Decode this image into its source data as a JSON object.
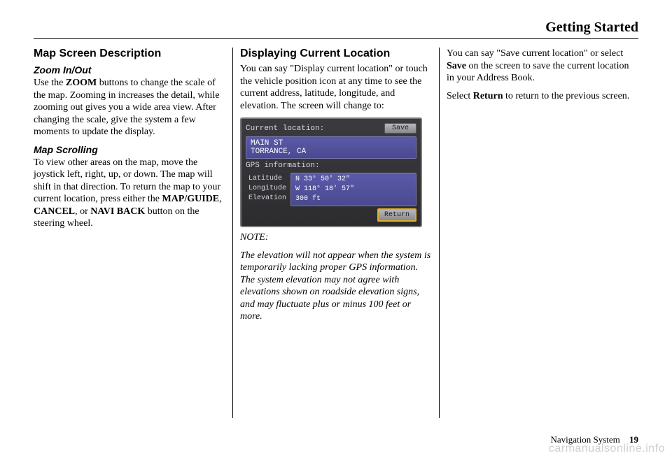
{
  "header": {
    "title": "Getting Started"
  },
  "col1": {
    "title": "Map Screen Description",
    "sub1": "Zoom In/Out",
    "para1a": "Use the ",
    "para1_bold": "ZOOM",
    "para1b": " buttons to change the scale of the map. Zooming in increases the detail, while zooming out gives you a wide area view. After changing the scale, give the system a few moments to update the display.",
    "sub2": "Map Scrolling",
    "para2a": "To view other areas on the map, move the joystick left, right, up, or down. The map will shift in that direction. To return the map to your current location, press either the ",
    "para2_b1": "MAP/GUIDE",
    "para2m": ", ",
    "para2_b2": "CANCEL",
    "para2n": ", or ",
    "para2_b3": "NAVI BACK",
    "para2c": " button on the steering wheel."
  },
  "col2": {
    "title": "Displaying Current Location",
    "para1": "You can say \"Display current location\" or touch the vehicle position icon at any time to see the current address, latitude, longitude, and elevation. The screen will change to:",
    "screen": {
      "curloc_label": "Current location:",
      "save_label": "Save",
      "addr_line1": "MAIN ST",
      "addr_line2": "TORRANCE, CA",
      "gps_label": "GPS information:",
      "lat_label": "Latitude",
      "lon_label": "Longitude",
      "elev_label": "Elevation",
      "lat_val": "N 33° 50' 32\"",
      "lon_val": "W 118° 18' 57\"",
      "elev_val": "300 ft",
      "return_label": "Return"
    },
    "note_label": "NOTE:",
    "note_text": "The elevation will not appear when the system is temporarily lacking proper GPS information. The system elevation may not agree with elevations shown on roadside elevation signs, and may fluctuate plus or minus 100 feet or more."
  },
  "col3": {
    "para1a": "You can say \"Save current location\" or select ",
    "para1_bold": "Save",
    "para1b": " on the screen to save the current location in your Address Book.",
    "para2a": "Select ",
    "para2_bold": "Return",
    "para2b": " to return to the previous screen."
  },
  "footer": {
    "label": "Navigation System",
    "page": "19"
  },
  "watermark": "carmanualsonline.info"
}
